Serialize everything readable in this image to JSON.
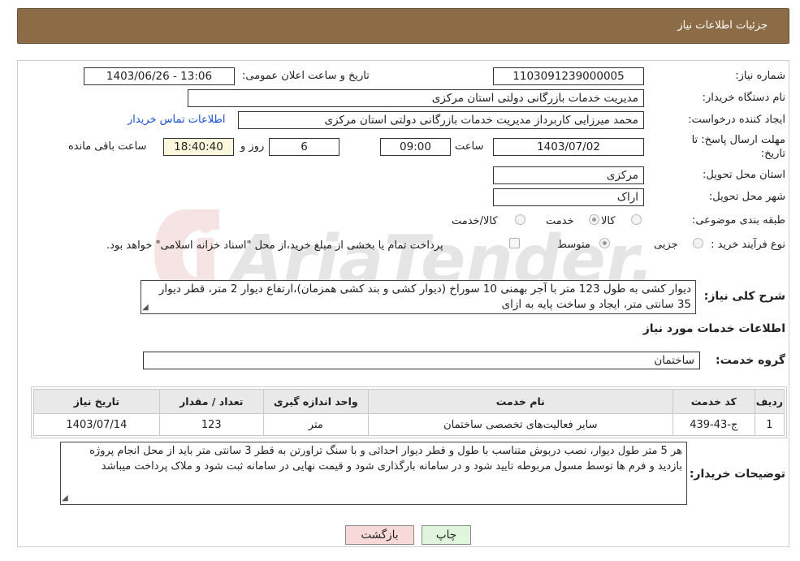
{
  "header": {
    "title": "جزئیات اطلاعات نیاز"
  },
  "form": {
    "need_number_label": "شماره نیاز:",
    "need_number": "1103091239000005",
    "announce_label": "تاریخ و ساعت اعلان عمومی:",
    "announce_value": "1403/06/26 - 13:06",
    "buyer_org_label": "نام دستگاه خریدار:",
    "buyer_org": "مدیریت خدمات بازرگانی دولتی استان مرکزی",
    "requester_label": "ایجاد کننده درخواست:",
    "requester": "محمد میرزایی کاربرداز مدیریت خدمات بازرگانی دولتی استان مرکزی",
    "contact_link": "اطلاعات تماس خریدار",
    "deadline_label_1": "مهلت ارسال پاسخ: تا",
    "deadline_label_2": "تاریخ:",
    "deadline_date": "1403/07/02",
    "time_label": "ساعت",
    "deadline_time": "09:00",
    "days_value": "6",
    "days_label": "روز و",
    "remaining_time": "18:40:40",
    "remaining_label": "ساعت باقی مانده",
    "province_label": "استان محل تحویل:",
    "province": "مرکزی",
    "city_label": "شهر محل تحویل:",
    "city": "اراک",
    "category_label": "طبقه بندی موضوعی:",
    "category_options": [
      "کالا",
      "خدمت",
      "کالا/خدمت"
    ],
    "category_selected": "خدمت",
    "process_label": "نوع فرآیند خرید :",
    "process_options": [
      "جزیی",
      "متوسط"
    ],
    "process_selected": "متوسط",
    "payment_note": "پرداخت تمام یا بخشی از مبلغ خرید،از محل \"اسناد خزانه اسلامی\" خواهد بود.",
    "description_label": "شرح کلی نیاز:",
    "description": "دیوار کشی به طول 123 متر با آجر بهمنی 10 سوراخ (دیوار کشی و بند کشی همزمان)،ارتفاع دیوار 2 متر، قطر دیوار 35 سانتی متر، ایجاد و ساخت پایه به ازای"
  },
  "services": {
    "section_title": "اطلاعات خدمات مورد نیاز",
    "group_label": "گروه خدمت:",
    "group_value": "ساختمان",
    "columns": [
      "ردیف",
      "کد خدمت",
      "نام خدمت",
      "واحد اندازه گیری",
      "تعداد / مقدار",
      "تاریخ نیاز"
    ],
    "rows": [
      [
        "1",
        "ج-43-439",
        "سایر فعالیت‌های تخصصی ساختمان",
        "متر",
        "123",
        "1403/07/14"
      ]
    ]
  },
  "buyer_notes": {
    "label": "توضیحات خریدار:",
    "text": "هر 5 متر طول دیوار، نصب دربوش متناسب با طول و قطر دیوار احداثی و با سنگ تراورتن به قطر 3 سانتی متر باید از محل انجام پروژه بازدید و فرم ها توسط مسول مربوطه تایید شود و در سامانه بارگذاری شود و قیمت نهایی در سامانه ثبت شود و ملاک پرداخت میباشد"
  },
  "buttons": {
    "print": "چاپ",
    "back": "بازگشت"
  },
  "watermark": {
    "text": "AriaTender.neT"
  },
  "colors": {
    "header_bg": "#8b6c46",
    "print_btn": "#dff5dc",
    "back_btn": "#f8d9d9",
    "link": "#1a4fd8"
  }
}
